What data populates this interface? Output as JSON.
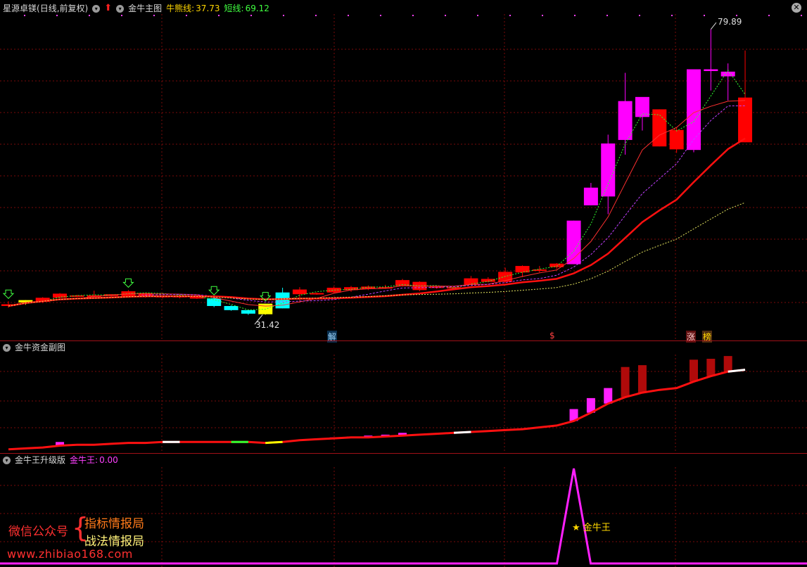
{
  "main_panel": {
    "stock_name": "星源卓镁",
    "period": "(日线,前复权)",
    "indicator_name": "金牛主图",
    "line1_label": "牛熊线:",
    "line1_value": "37.73",
    "line2_label": "短线:",
    "line2_value": "69.12",
    "high_label": "79.89",
    "low_label": "31.42",
    "markers": [
      "解",
      "$",
      "涨",
      "榜"
    ]
  },
  "sub_panel1": {
    "title": "金牛资金副图"
  },
  "sub_panel2": {
    "title": "金牛王升级版",
    "value_label": "金牛王:",
    "value": "0.00",
    "star_label": "★ 金牛王"
  },
  "watermark": {
    "left": "微信公众号",
    "line1": "指标情报局",
    "line2": "战法情报局",
    "url": "www.zhibiao168.com"
  },
  "colors": {
    "up": "#ff0000",
    "up_strong": "#ff00ff",
    "down": "#00ffff",
    "neutral": "#ffff00",
    "grid": "#7a0a0a",
    "separator": "#a01018"
  },
  "chart_data": [
    {
      "type": "candlestick",
      "title": "金牛主图",
      "ylim": [
        28,
        82
      ],
      "candles": [
        {
          "o": 33.2,
          "h": 33.7,
          "l": 32.6,
          "c": 32.9,
          "col": "up"
        },
        {
          "o": 33.5,
          "h": 33.9,
          "l": 33.1,
          "c": 33.9,
          "col": "neutral"
        },
        {
          "o": 33.6,
          "h": 34.4,
          "l": 33.4,
          "c": 34.3,
          "col": "up"
        },
        {
          "o": 34.3,
          "h": 35.1,
          "l": 34.2,
          "c": 35.0,
          "col": "up"
        },
        {
          "o": 34.6,
          "h": 34.8,
          "l": 34.4,
          "c": 34.7,
          "col": "up"
        },
        {
          "o": 34.6,
          "h": 35.5,
          "l": 34.3,
          "c": 34.7,
          "col": "up"
        },
        {
          "o": 34.6,
          "h": 34.9,
          "l": 34.3,
          "c": 34.9,
          "col": "up"
        },
        {
          "o": 34.4,
          "h": 35.6,
          "l": 34.3,
          "c": 35.4,
          "col": "up"
        },
        {
          "o": 34.5,
          "h": 35.1,
          "l": 34.3,
          "c": 35.1,
          "col": "up"
        },
        {
          "o": 34.5,
          "h": 34.7,
          "l": 34.2,
          "c": 34.6,
          "col": "up"
        },
        {
          "o": 34.5,
          "h": 34.7,
          "l": 34.2,
          "c": 34.6,
          "col": "up"
        },
        {
          "o": 34.3,
          "h": 34.5,
          "l": 34.1,
          "c": 34.4,
          "col": "up"
        },
        {
          "o": 34.2,
          "h": 34.3,
          "l": 32.7,
          "c": 32.9,
          "col": "down"
        },
        {
          "o": 32.9,
          "h": 33.0,
          "l": 32.1,
          "c": 32.2,
          "col": "down"
        },
        {
          "o": 32.2,
          "h": 32.3,
          "l": 31.4,
          "c": 31.6,
          "col": "down"
        },
        {
          "o": 31.5,
          "h": 33.3,
          "l": 31.42,
          "c": 33.3,
          "col": "neutral"
        },
        {
          "o": 32.5,
          "h": 36.0,
          "l": 32.5,
          "c": 35.2,
          "col": "down"
        },
        {
          "o": 34.9,
          "h": 36.1,
          "l": 33.8,
          "c": 35.7,
          "col": "up"
        },
        {
          "o": 35.0,
          "h": 35.2,
          "l": 34.8,
          "c": 35.1,
          "col": "up"
        },
        {
          "o": 35.2,
          "h": 36.2,
          "l": 35.0,
          "c": 36.0,
          "col": "up"
        },
        {
          "o": 35.6,
          "h": 36.3,
          "l": 35.3,
          "c": 36.1,
          "col": "up"
        },
        {
          "o": 35.8,
          "h": 36.4,
          "l": 35.6,
          "c": 36.2,
          "col": "up"
        },
        {
          "o": 36.0,
          "h": 36.5,
          "l": 35.8,
          "c": 36.1,
          "col": "up"
        },
        {
          "o": 36.3,
          "h": 37.5,
          "l": 36.2,
          "c": 37.3,
          "col": "up"
        },
        {
          "o": 37.0,
          "h": 37.1,
          "l": 35.4,
          "c": 35.6,
          "col": "up"
        },
        {
          "o": 36.0,
          "h": 36.3,
          "l": 35.8,
          "c": 36.2,
          "col": "up"
        },
        {
          "o": 36.0,
          "h": 36.3,
          "l": 35.7,
          "c": 36.1,
          "col": "up"
        },
        {
          "o": 36.5,
          "h": 38.0,
          "l": 36.4,
          "c": 37.6,
          "col": "up"
        },
        {
          "o": 37.0,
          "h": 37.8,
          "l": 36.9,
          "c": 37.5,
          "col": "up"
        },
        {
          "o": 37.0,
          "h": 39.4,
          "l": 36.9,
          "c": 38.7,
          "col": "up"
        },
        {
          "o": 38.6,
          "h": 39.8,
          "l": 37.8,
          "c": 39.7,
          "col": "up"
        },
        {
          "o": 38.9,
          "h": 39.7,
          "l": 38.6,
          "c": 39.1,
          "col": "up"
        },
        {
          "o": 39.5,
          "h": 40.2,
          "l": 39.2,
          "c": 40.1,
          "col": "up"
        },
        {
          "o": 40.0,
          "h": 47.4,
          "l": 40.0,
          "c": 47.4,
          "col": "up_strong"
        },
        {
          "o": 50.0,
          "h": 53.8,
          "l": 50.0,
          "c": 53.0,
          "col": "up_strong"
        },
        {
          "o": 51.5,
          "h": 62.0,
          "l": 48.5,
          "c": 60.5,
          "col": "up_strong"
        },
        {
          "o": 61.1,
          "h": 72.5,
          "l": 58.6,
          "c": 67.7,
          "col": "up_strong"
        },
        {
          "o": 65.0,
          "h": 68.0,
          "l": 62.7,
          "c": 68.4,
          "col": "up_strong"
        },
        {
          "o": 66.3,
          "h": 66.3,
          "l": 60.0,
          "c": 60.0,
          "col": "up"
        },
        {
          "o": 62.8,
          "h": 63.2,
          "l": 58.9,
          "c": 59.5,
          "col": "up"
        },
        {
          "o": 59.4,
          "h": 73.1,
          "l": 59.0,
          "c": 73.1,
          "col": "up_strong"
        },
        {
          "o": 72.8,
          "h": 79.89,
          "l": 69.5,
          "c": 73.1,
          "col": "up_strong"
        },
        {
          "o": 71.9,
          "h": 74.1,
          "l": 67.8,
          "c": 72.7,
          "col": "up_strong"
        },
        {
          "o": 68.3,
          "h": 76.3,
          "l": 60.7,
          "c": 60.7,
          "col": "up"
        }
      ]
    },
    {
      "type": "bar",
      "title": "金牛资金副图",
      "ylim": [
        0,
        10
      ],
      "line": [
        0.1,
        0.2,
        0.3,
        0.5,
        0.6,
        0.6,
        0.7,
        0.8,
        0.8,
        0.9,
        0.9,
        0.9,
        0.9,
        0.9,
        0.9,
        0.8,
        0.9,
        1.1,
        1.2,
        1.3,
        1.4,
        1.4,
        1.5,
        1.6,
        1.7,
        1.8,
        1.9,
        2.0,
        2.1,
        2.2,
        2.3,
        2.5,
        2.7,
        3.2,
        4.1,
        5.1,
        5.8,
        6.3,
        6.6,
        6.8,
        7.5,
        8.1,
        8.6,
        8.8
      ],
      "bars": [
        0,
        0,
        0,
        0.9,
        0,
        0,
        0,
        0,
        0,
        0,
        0,
        0,
        0,
        0,
        0,
        0.4,
        0,
        0,
        0,
        1.4,
        1.5,
        1.6,
        1.7,
        1.9,
        0,
        0,
        0,
        0,
        0,
        0,
        0,
        0,
        0,
        4.5,
        5.7,
        6.8,
        9.1,
        9.3,
        0,
        0,
        9.9,
        10.0,
        10.3,
        0
      ]
    },
    {
      "type": "line",
      "title": "金牛王",
      "ylim": [
        0,
        1
      ],
      "values": [
        0,
        0,
        0,
        0,
        0,
        0,
        0,
        0,
        0,
        0,
        0,
        0,
        0,
        0,
        0,
        0,
        0,
        0,
        0,
        0,
        0,
        0,
        0,
        0,
        0,
        0,
        0,
        0,
        0,
        0,
        0,
        0,
        0,
        1,
        0,
        0,
        0,
        0,
        0,
        0,
        0,
        0,
        0,
        0
      ]
    }
  ]
}
